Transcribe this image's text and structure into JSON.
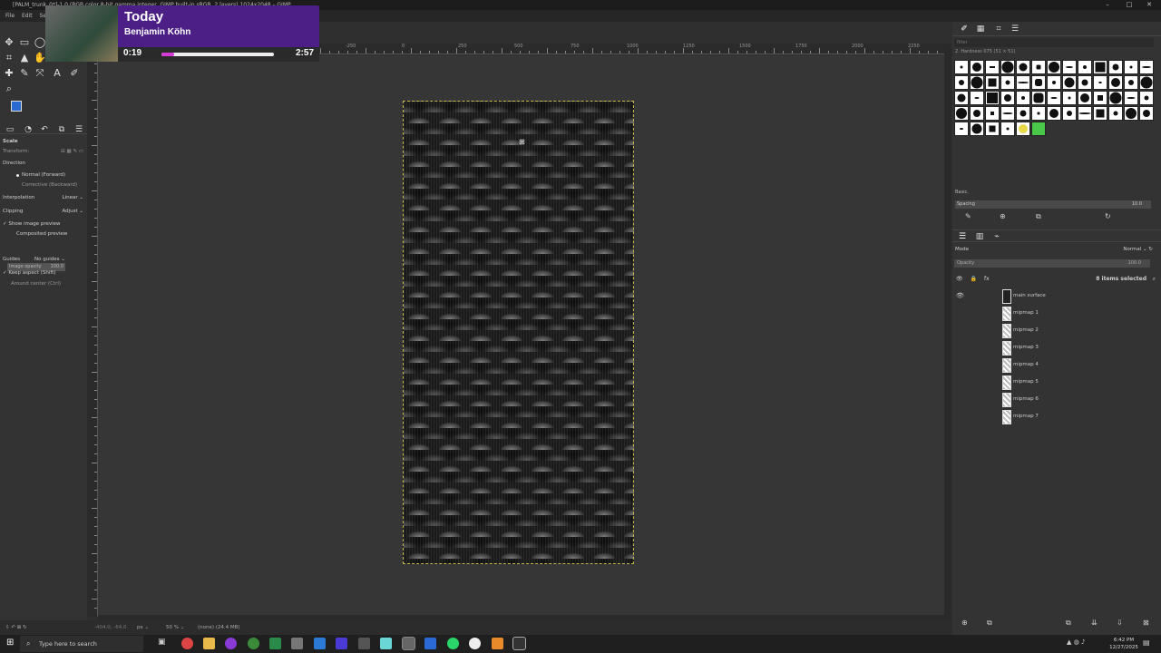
{
  "window": {
    "title": "[PALM_trunk_0*]-1.0 (RGB color 8-bit gamma integer, GIMP built-in sRGB, 2 layers) 1024x2048 – GIMP"
  },
  "menu": [
    "File",
    "Edit",
    "Select"
  ],
  "overlay": {
    "title": "Today",
    "artist": "Benjamin Köhn",
    "elapsed": "0:19",
    "total": "2:57",
    "progress": 0.11
  },
  "tool_options": {
    "title": "Scale",
    "transform_label": "Transform:",
    "direction_label": "Direction",
    "direction_normal": "Normal (Forward)",
    "direction_corrective": "Corrective (Backward)",
    "interpolation_label": "Interpolation",
    "interpolation_value": "Linear",
    "clipping_label": "Clipping",
    "clipping_value": "Adjust",
    "show_preview": "Show image preview",
    "composited_preview": "Composited preview",
    "image_opacity_label": "Image opacity",
    "image_opacity_value": "100.0",
    "guides_label": "Guides",
    "guides_value": "No guides",
    "keep_aspect": "Keep aspect (Shift)",
    "around_center": "Around center (Ctrl)"
  },
  "ruler": {
    "labels": [
      "-250",
      "0",
      "250",
      "500",
      "750",
      "1000",
      "1250",
      "1500",
      "1750",
      "2000",
      "2250"
    ]
  },
  "status": {
    "coords": "-404.0, -64.0",
    "unit": "px",
    "zoom": "50 %",
    "info": "(none) (24.4 MB)"
  },
  "brushes": {
    "filter_placeholder": "filter",
    "name": "2. Hardness 075 (51 × 51)",
    "preset": "Basic,",
    "spacing_label": "Spacing",
    "spacing_value": "10.0"
  },
  "layers": {
    "mode_label": "Mode",
    "mode_value": "Normal",
    "opacity_label": "Opacity",
    "opacity_value": "100.0",
    "selected_info": "8 items selected",
    "items": [
      "main surface",
      "mipmap 1",
      "mipmap 2",
      "mipmap 3",
      "mipmap 4",
      "mipmap 5",
      "mipmap 6",
      "mipmap 7"
    ]
  },
  "taskbar": {
    "search_placeholder": "Type here to search",
    "time": "6:42 PM",
    "date": "12/27/2025"
  },
  "colors": {
    "accent": "#2a6bd1",
    "overlay": "#4b1f86",
    "progress": "#d63ad6",
    "selection": "#c8b84a"
  }
}
